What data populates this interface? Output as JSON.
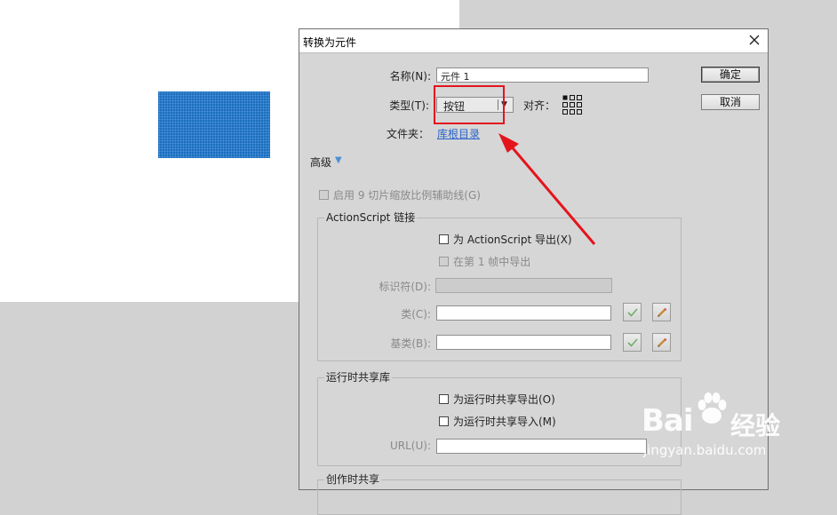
{
  "dialog": {
    "title": "转换为元件",
    "name_label": "名称(N):",
    "name_value": "元件 1",
    "type_label": "类型(T):",
    "type_value": "按钮",
    "align_label": "对齐：",
    "folder_label": "文件夹：",
    "folder_link": "库根目录",
    "ok_button": "确定",
    "cancel_button": "取消",
    "advanced_label": "高级",
    "enable_9slice": "启用 9 切片缩放比例辅助线(G)",
    "actionscript": {
      "group_title": "ActionScript 链接",
      "export_for_as": "为 ActionScript 导出(X)",
      "export_in_frame": "在第 1 帧中导出",
      "identifier_label": "标识符(D):",
      "class_label": "类(C):",
      "base_class_label": "基类(B):"
    },
    "runtime_shared": {
      "group_title": "运行时共享库",
      "export_runtime": "为运行时共享导出(O)",
      "import_runtime": "为运行时共享导入(M)",
      "url_label": "URL(U):"
    },
    "authortime_shared": {
      "group_title": "创作时共享"
    }
  },
  "watermark": {
    "brand": "Bai",
    "brand2": "经验",
    "url": "jingyan.baidu.com"
  },
  "colors": {
    "stage_white": "#ffffff",
    "shape_blue": "#1c6fbf",
    "highlight_red": "#e4141d",
    "link_blue": "#2a63c8"
  }
}
